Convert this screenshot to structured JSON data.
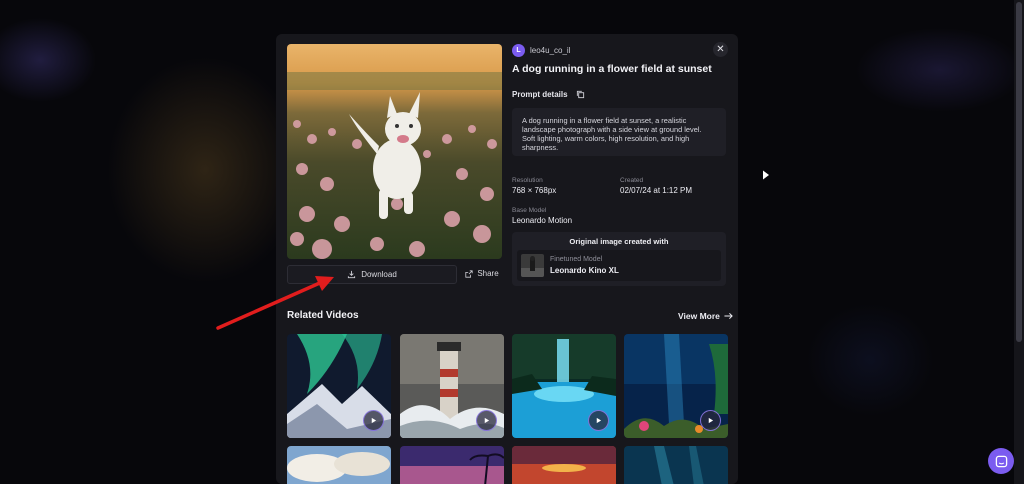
{
  "user": {
    "avatar_letter": "L",
    "username": "leo4u_co_il"
  },
  "title": "A dog running in a flower field at sunset",
  "prompt": {
    "label": "Prompt details",
    "text": "A dog running in a flower field at sunset, a realistic landscape photograph with a side view at ground level. Soft lighting, warm colors, high resolution, and high sharpness."
  },
  "meta": {
    "resolution_label": "Resolution",
    "resolution_value": "768 × 768px",
    "created_label": "Created",
    "created_value": "02/07/24 at 1:12 PM",
    "base_model_label": "Base Model",
    "base_model_value": "Leonardo Motion"
  },
  "original": {
    "title": "Original image created with",
    "model_type": "Finetuned Model",
    "model_name": "Leonardo Kino XL"
  },
  "actions": {
    "download_label": "Download",
    "share_label": "Share"
  },
  "related": {
    "title": "Related Videos",
    "view_more": "View More",
    "videos": [
      {
        "name": "aurora-mountains",
        "icon": "play-icon"
      },
      {
        "name": "lighthouse-waves",
        "icon": "play-icon"
      },
      {
        "name": "blue-waterfall-pool",
        "icon": "play-icon"
      },
      {
        "name": "underwater-reef",
        "icon": "play-icon"
      },
      {
        "name": "clouds-sky"
      },
      {
        "name": "palm-sunset"
      },
      {
        "name": "ocean-sunset"
      },
      {
        "name": "underwater-rays"
      }
    ]
  },
  "colors": {
    "accent": "#7b5cf0",
    "modal_bg": "#17171c",
    "annotation_arrow": "#e11d1d"
  }
}
